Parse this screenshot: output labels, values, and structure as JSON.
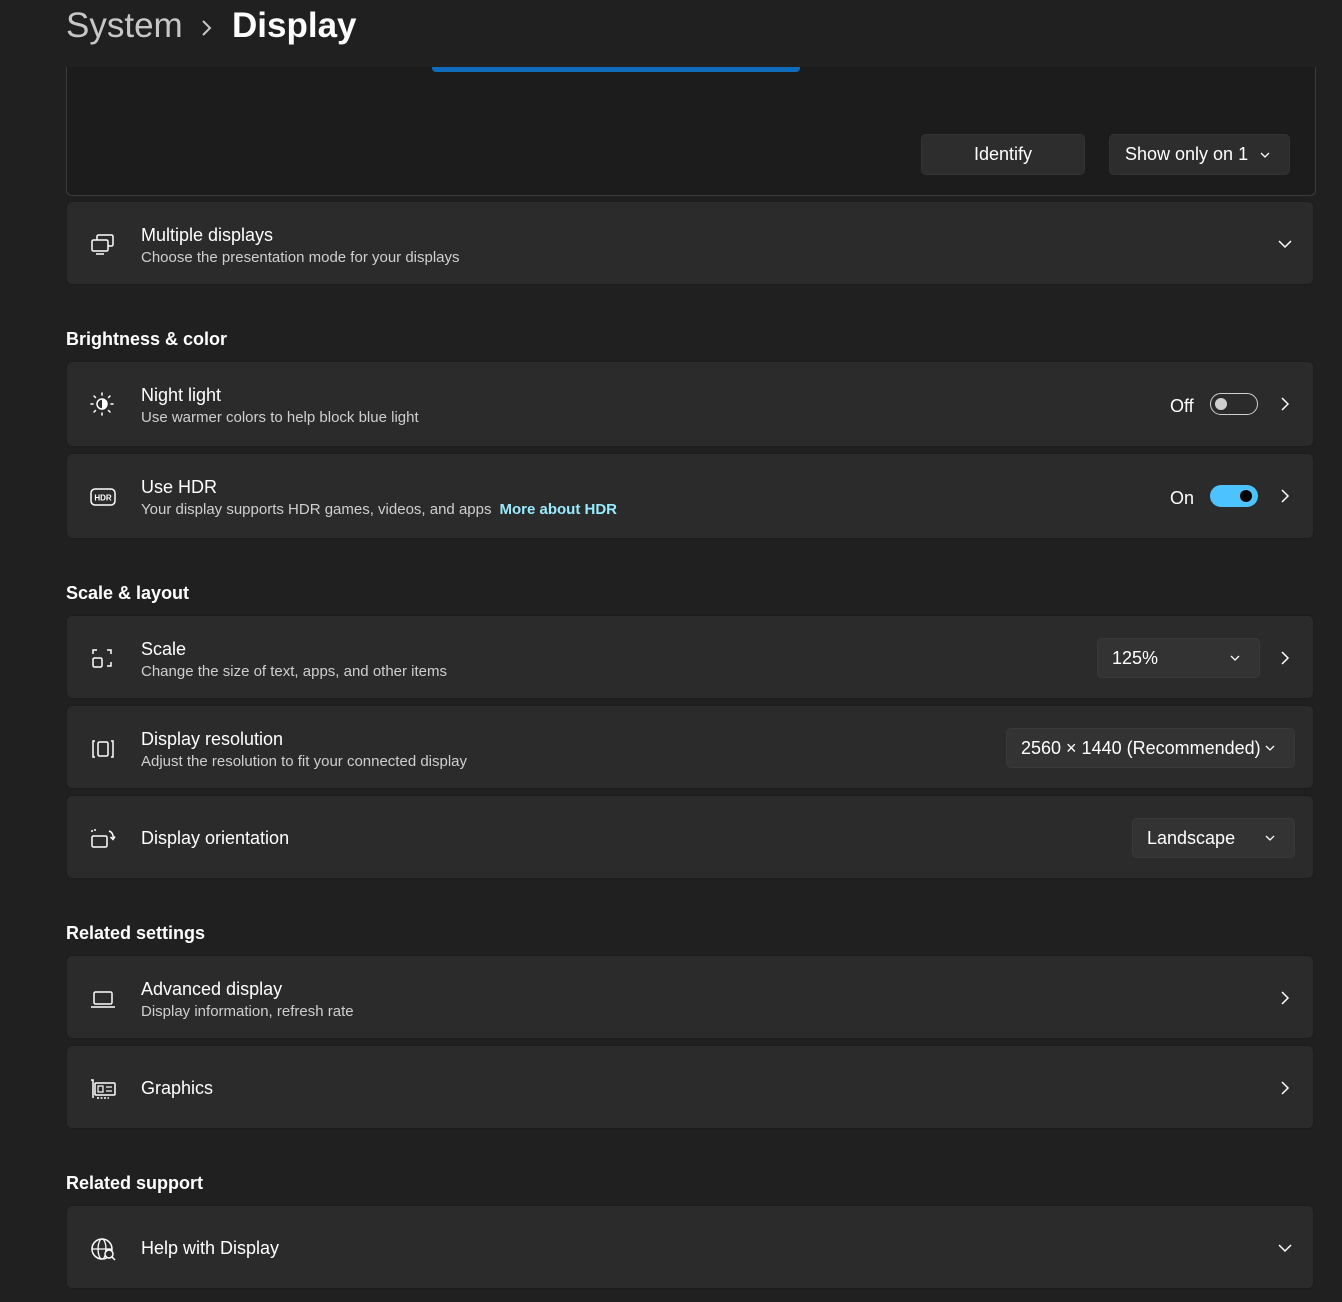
{
  "breadcrumb": {
    "parent": "System",
    "current": "Display"
  },
  "monitor_panel": {
    "identify_label": "Identify",
    "show_only_value": "Show only on 1"
  },
  "multiple_displays": {
    "title": "Multiple displays",
    "subtitle": "Choose the presentation mode for your displays"
  },
  "sections": {
    "brightness": "Brightness & color",
    "scale_layout": "Scale & layout",
    "related_settings": "Related settings",
    "related_support": "Related support"
  },
  "night_light": {
    "title": "Night light",
    "subtitle": "Use warmer colors to help block blue light",
    "state": "Off"
  },
  "hdr": {
    "title": "Use HDR",
    "subtitle": "Your display supports HDR games, videos, and apps",
    "link": "More about HDR",
    "state": "On"
  },
  "scale": {
    "title": "Scale",
    "subtitle": "Change the size of text, apps, and other items",
    "value": "125%"
  },
  "resolution": {
    "title": "Display resolution",
    "subtitle": "Adjust the resolution to fit your connected display",
    "value": "2560 × 1440 (Recommended)"
  },
  "orientation": {
    "title": "Display orientation",
    "value": "Landscape"
  },
  "advanced_display": {
    "title": "Advanced display",
    "subtitle": "Display information, refresh rate"
  },
  "graphics": {
    "title": "Graphics"
  },
  "help_display": {
    "title": "Help with Display"
  },
  "colors": {
    "accent": "#4cc2ff",
    "link": "#99ebff",
    "card": "#2b2b2b",
    "background": "#202020"
  }
}
